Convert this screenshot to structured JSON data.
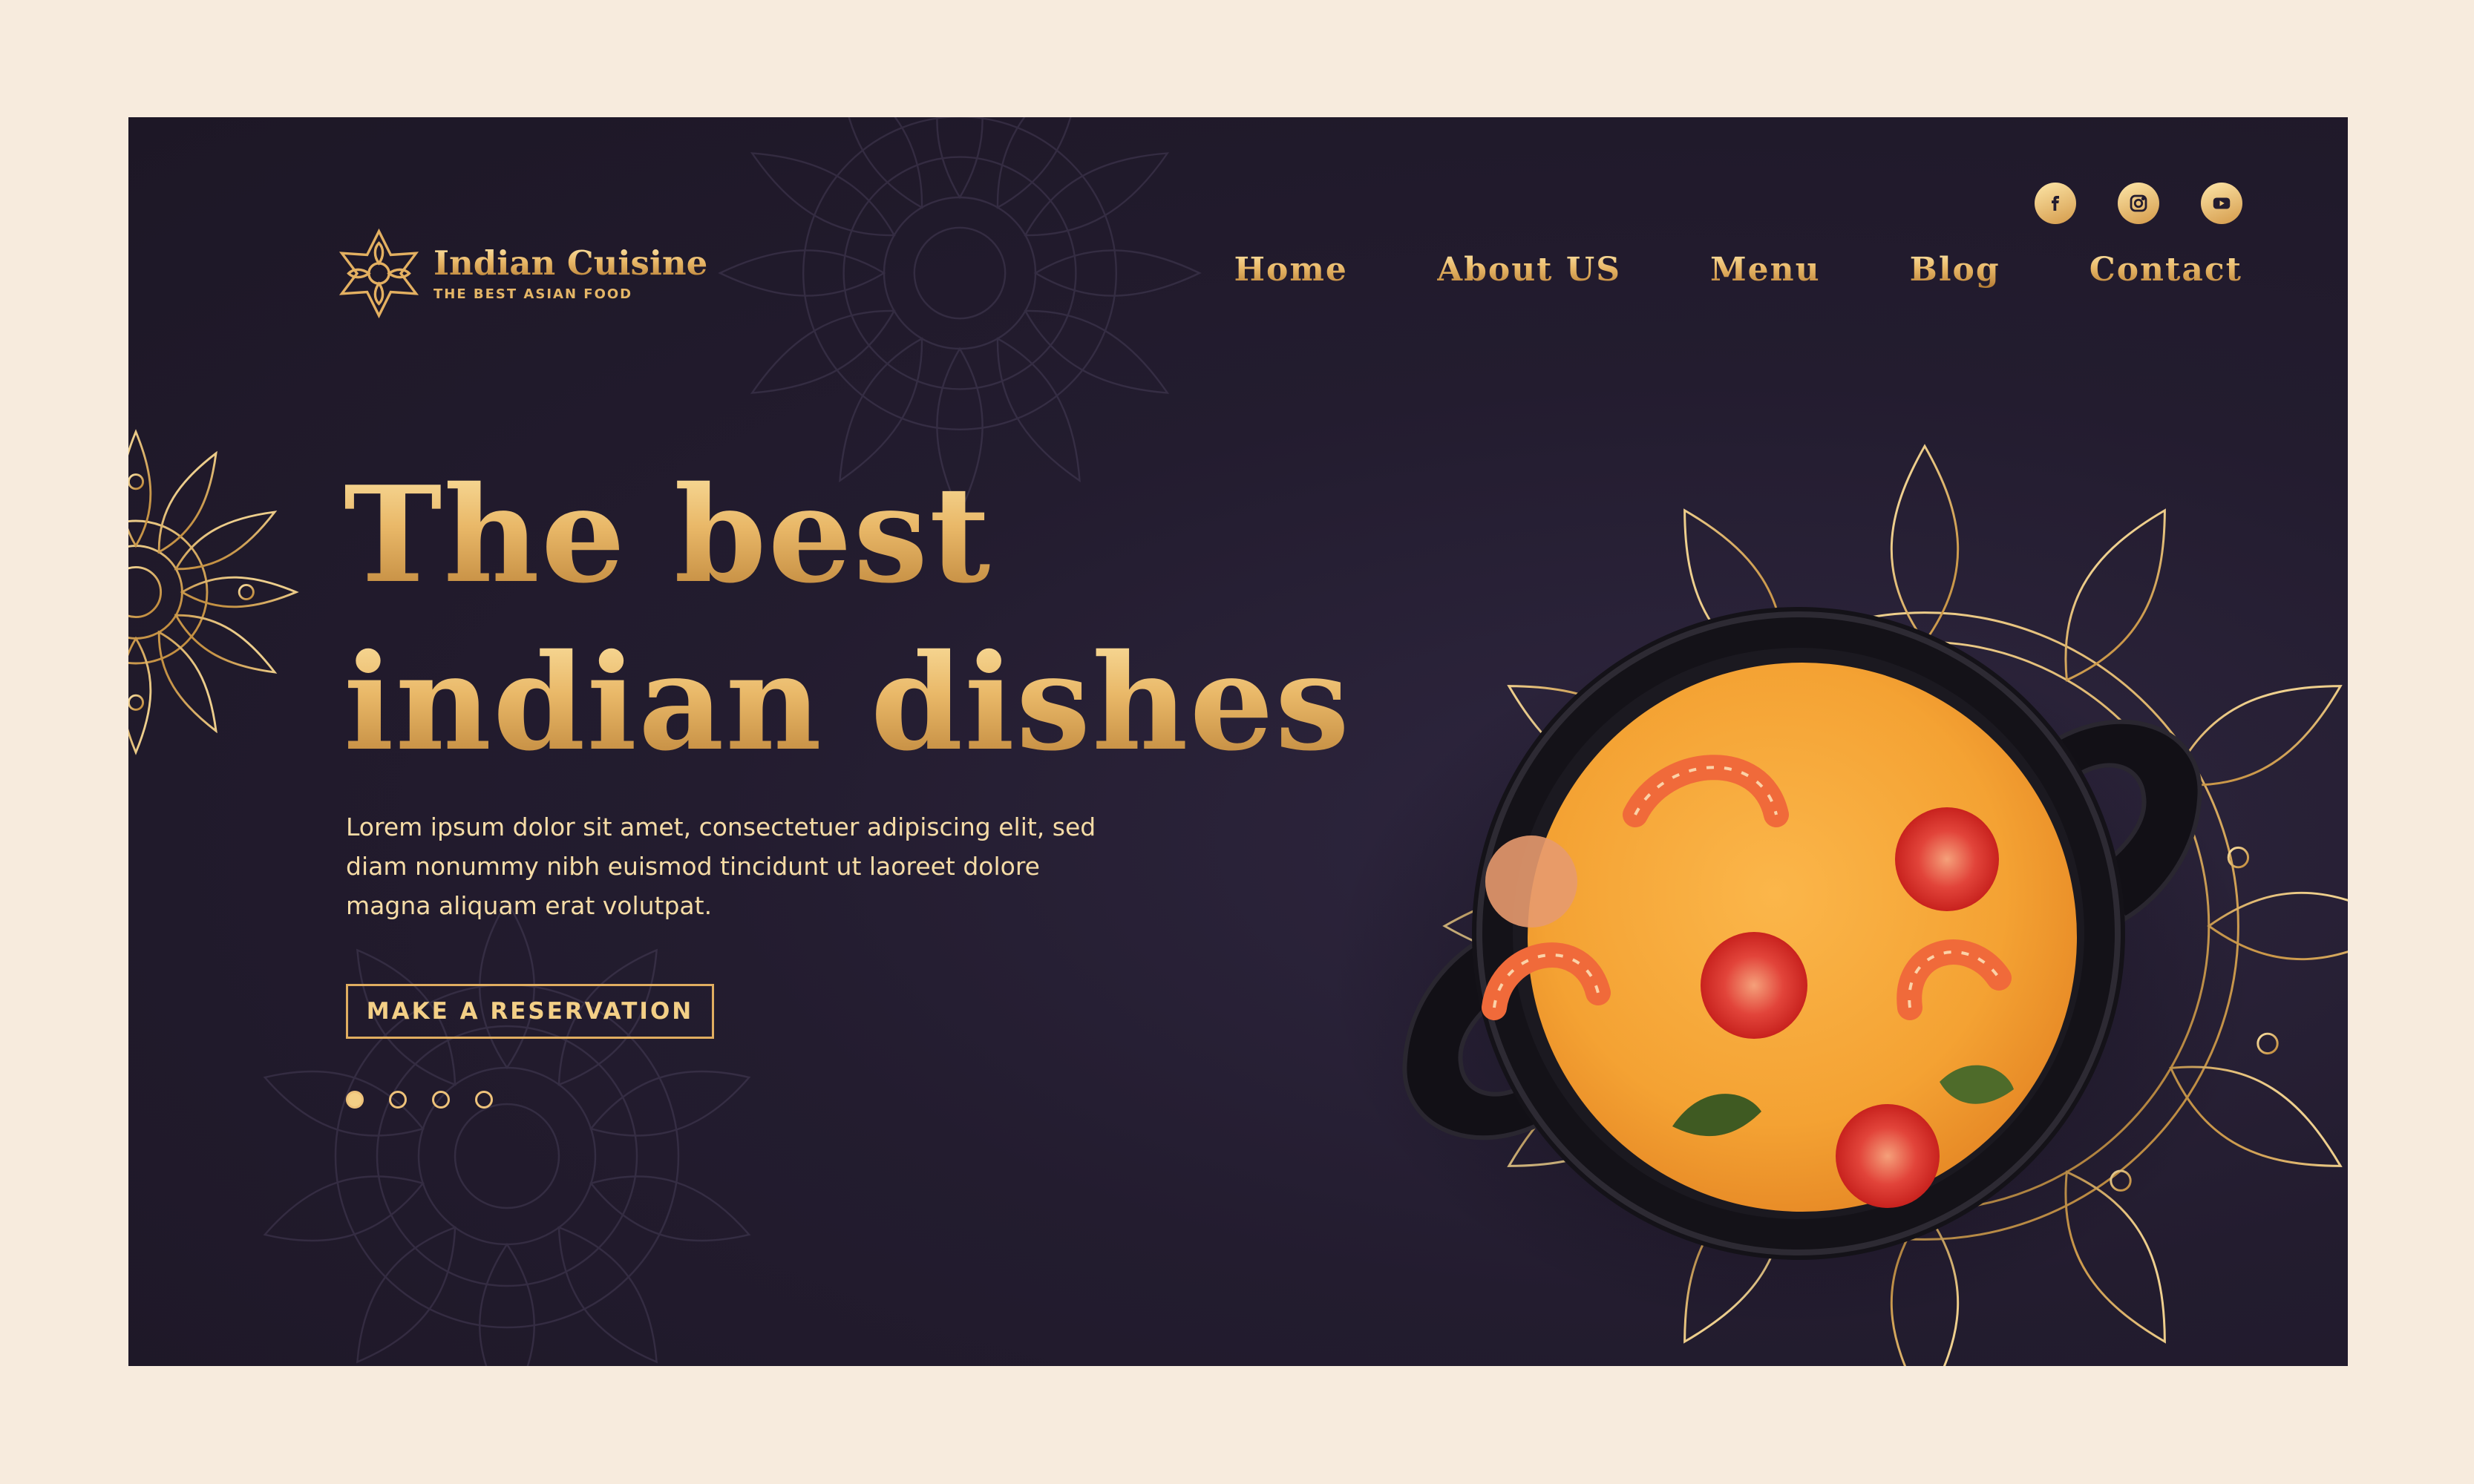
{
  "brand": {
    "name": "Indian Cuisine",
    "tagline": "THE BEST ASIAN FOOD"
  },
  "nav": {
    "items": [
      "Home",
      "About US",
      "Menu",
      "Blog",
      "Contact"
    ]
  },
  "social": [
    "facebook-icon",
    "instagram-icon",
    "youtube-icon"
  ],
  "hero": {
    "title_line1": "The best",
    "title_line2": "indian dishes",
    "description": "Lorem ipsum dolor sit amet, consectetuer adipiscing elit, sed diam nonummy nibh euismod tincidunt ut laoreet dolore magna aliquam erat volutpat.",
    "cta_label": "MAKE A RESERVATION"
  },
  "slider": {
    "count": 4,
    "active": 1
  },
  "colors": {
    "gold": "#e9b868",
    "background": "#231c2f",
    "page": "#f7ebdd"
  }
}
